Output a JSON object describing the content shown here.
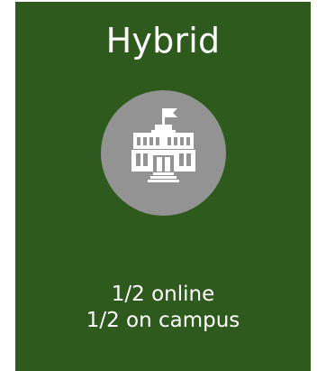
{
  "card": {
    "title": "Hybrid",
    "icon": "school-building-icon",
    "description_lines": [
      "1/2 online",
      "1/2 on campus"
    ]
  },
  "colors": {
    "card_background": "#2f5a1e",
    "icon_circle": "#939393",
    "icon_foreground": "#ffffff",
    "text": "#ffffff"
  }
}
